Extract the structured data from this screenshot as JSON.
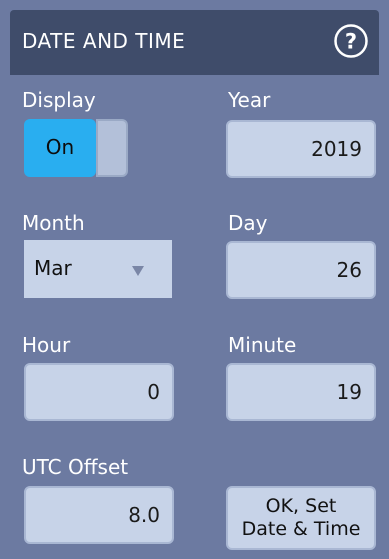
{
  "dialog": {
    "title": "DATE AND TIME",
    "help_icon": "help-circle-icon"
  },
  "display": {
    "label": "Display",
    "value": "On"
  },
  "year": {
    "label": "Year",
    "value": "2019"
  },
  "month": {
    "label": "Month",
    "value": "Mar"
  },
  "day": {
    "label": "Day",
    "value": "26"
  },
  "hour": {
    "label": "Hour",
    "value": "0"
  },
  "minute": {
    "label": "Minute",
    "value": "19"
  },
  "utc_offset": {
    "label": "UTC Offset",
    "value": "8.0"
  },
  "ok_button": {
    "line1": "OK, Set",
    "line2": "Date & Time"
  },
  "colors": {
    "panel": "#6c7aa1",
    "titlebar": "#3f4c6a",
    "accent": "#29aef0",
    "field": "#c7d3e8"
  }
}
